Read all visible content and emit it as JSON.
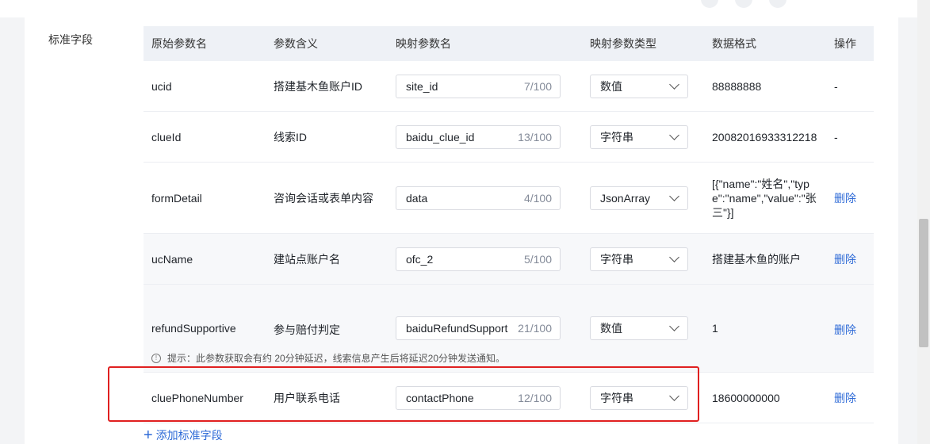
{
  "section_label": "标准字段",
  "headers": [
    "原始参数名",
    "参数含义",
    "映射参数名",
    "映射参数类型",
    "数据格式",
    "操作"
  ],
  "rows": [
    {
      "name": "ucid",
      "meaning": "搭建基木鱼账户ID",
      "mapped": "site_id",
      "count": "7/100",
      "type": "数值",
      "format": "88888888",
      "action": "-"
    },
    {
      "name": "clueId",
      "meaning": "线索ID",
      "mapped": "baidu_clue_id",
      "count": "13/100",
      "type": "字符串",
      "format": "20082016933312218",
      "action": "-"
    },
    {
      "name": "formDetail",
      "meaning": "咨询会话或表单内容",
      "mapped": "data",
      "count": "4/100",
      "type": "JsonArray",
      "format": "[{\"name\":\"姓名\",\"type\":\"name\",\"value\":\"张三\"}]",
      "action": "删除"
    },
    {
      "name": "ucName",
      "meaning": "建站点账户名",
      "mapped": "ofc_2",
      "count": "5/100",
      "type": "字符串",
      "format": "搭建基木鱼的账户",
      "action": "删除"
    },
    {
      "name": "refundSupportive",
      "meaning": "参与赔付判定",
      "mapped": "baiduRefundSupport",
      "count": "21/100",
      "type": "数值",
      "format": "1",
      "action": "删除",
      "hint": "提示：此参数获取会有约 20分钟延迟，线索信息产生后将延迟20分钟发送通知。"
    },
    {
      "name": "cluePhoneNumber",
      "meaning": "用户联系电话",
      "mapped": "contactPhone",
      "count": "12/100",
      "type": "字符串",
      "format": "18600000000",
      "action": "删除"
    }
  ],
  "add_label": "添加标准字段",
  "colors": {
    "link": "#2f6bd7",
    "header_bg": "#eef1f6",
    "highlight": "#e02020"
  }
}
